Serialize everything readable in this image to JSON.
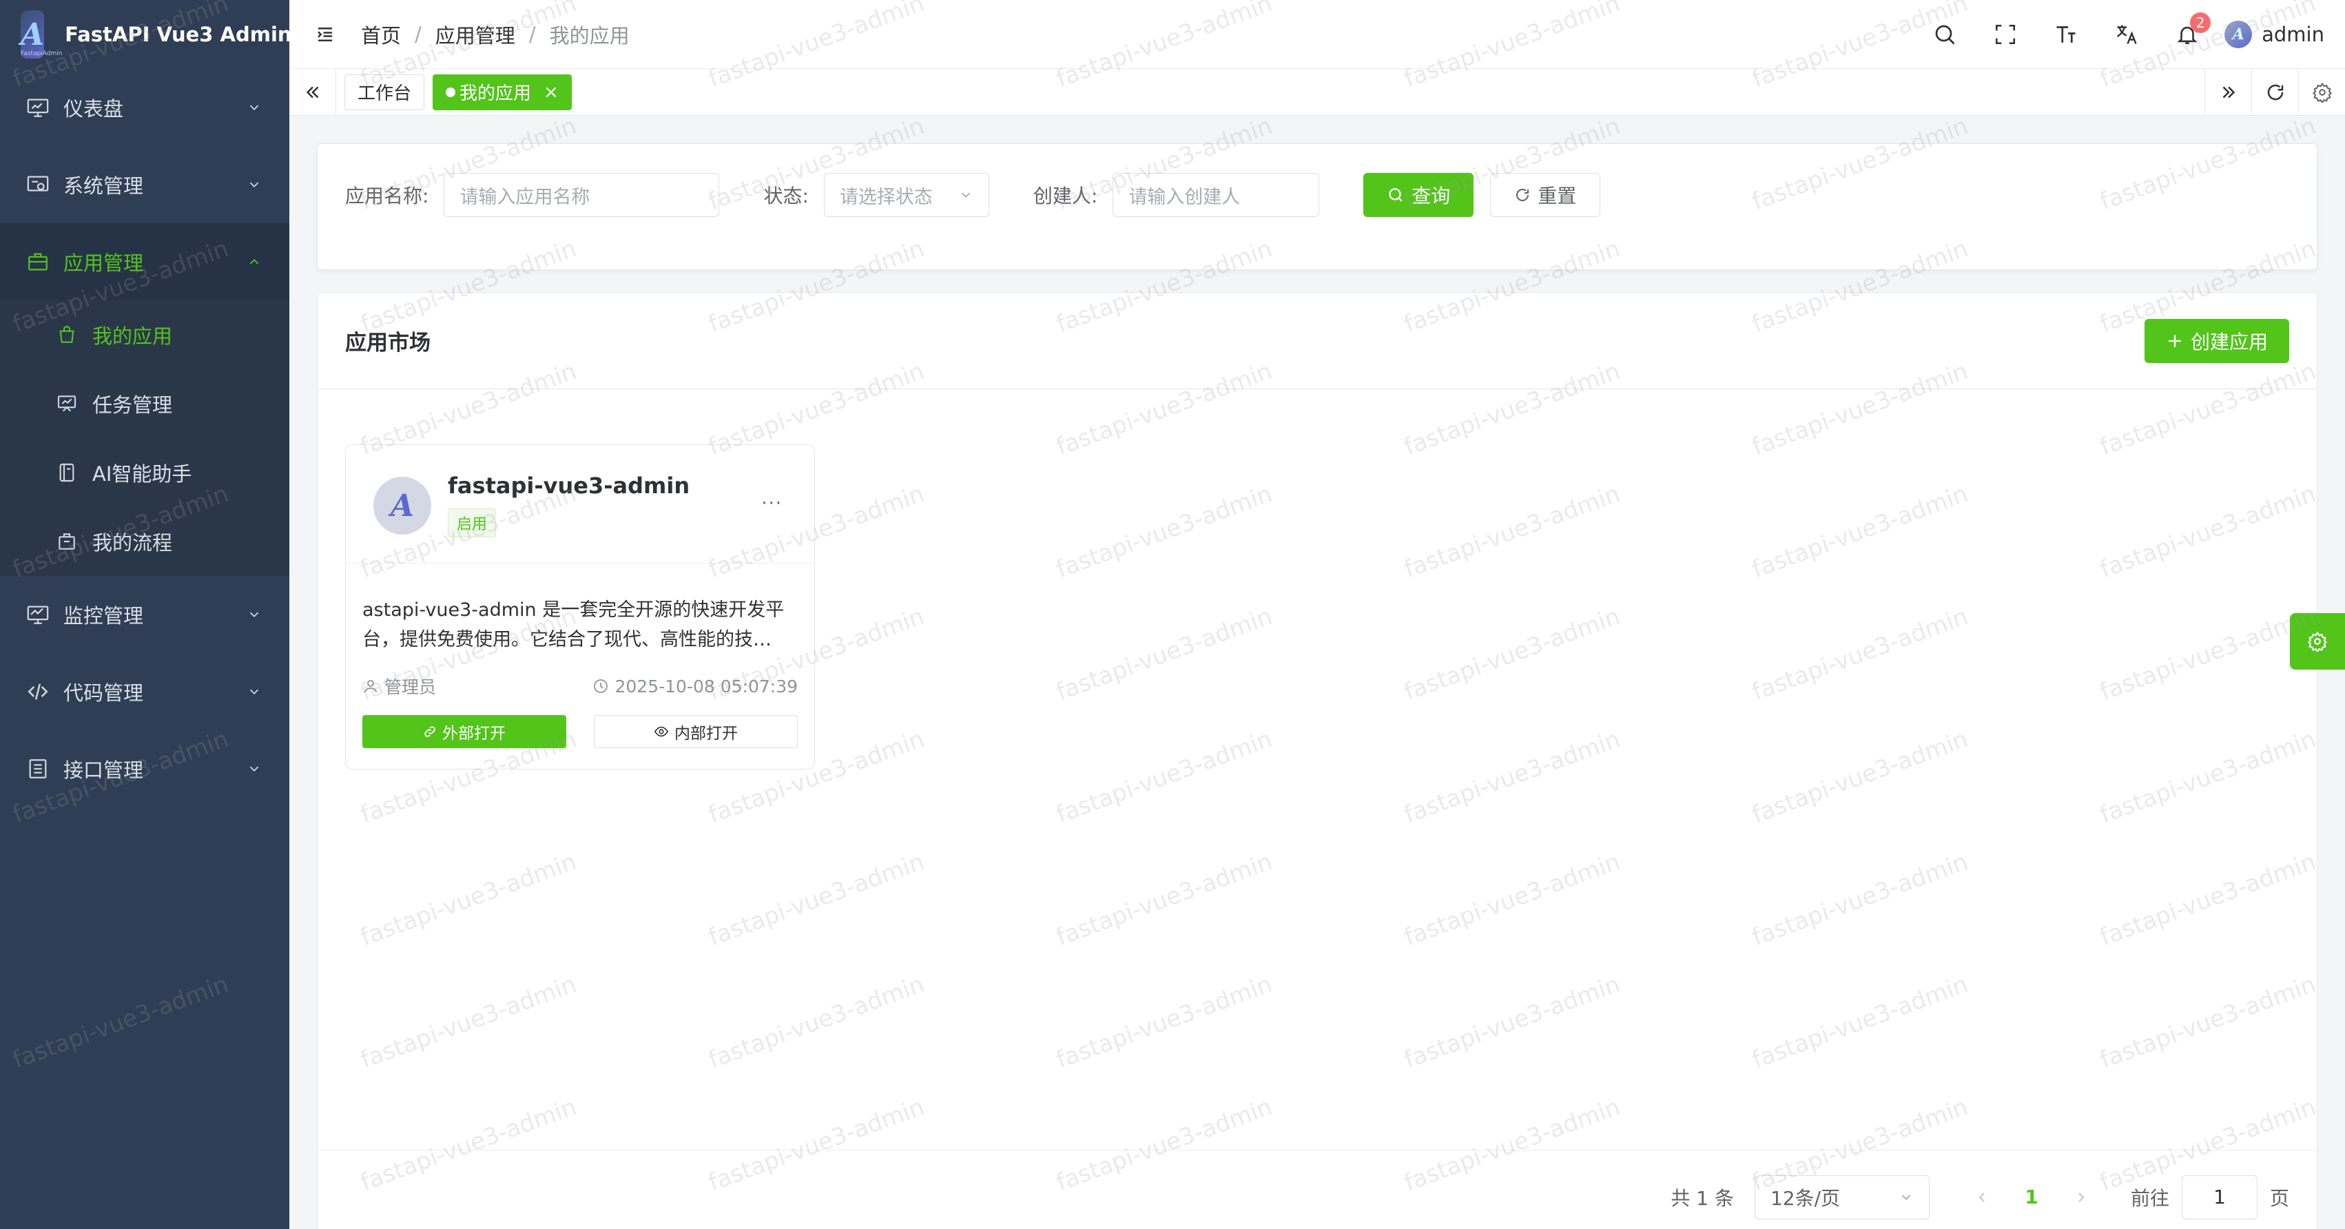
{
  "app": {
    "title": "FastAPI Vue3 Admin",
    "logo_caption": "FastapiAdmin",
    "logo_glyph": "A"
  },
  "sidebar": {
    "items": [
      {
        "label": "仪表盘",
        "icon": "monitor-icon",
        "expanded": false
      },
      {
        "label": "系统管理",
        "icon": "system-settings-icon",
        "expanded": false
      },
      {
        "label": "应用管理",
        "icon": "briefcase-icon",
        "expanded": true,
        "active": true
      },
      {
        "label": "监控管理",
        "icon": "chart-monitor-icon",
        "expanded": false
      },
      {
        "label": "代码管理",
        "icon": "code-icon",
        "expanded": false
      },
      {
        "label": "接口管理",
        "icon": "document-list-icon",
        "expanded": false
      }
    ],
    "subitems": [
      {
        "label": "我的应用",
        "icon": "shopping-bag-icon",
        "active": true
      },
      {
        "label": "任务管理",
        "icon": "presentation-icon"
      },
      {
        "label": "AI智能助手",
        "icon": "ai-notebook-icon"
      },
      {
        "label": "我的流程",
        "icon": "flow-bag-icon"
      }
    ]
  },
  "header": {
    "breadcrumb": [
      "首页",
      "应用管理",
      "我的应用"
    ],
    "notification_count": "2",
    "username": "admin",
    "avatar_glyph": "A"
  },
  "tabs": [
    {
      "label": "工作台",
      "active": false
    },
    {
      "label": "我的应用",
      "active": true,
      "close": "×"
    }
  ],
  "search": {
    "name_label": "应用名称:",
    "name_placeholder": "请输入应用名称",
    "status_label": "状态:",
    "status_placeholder": "请选择状态",
    "creator_label": "创建人:",
    "creator_placeholder": "请输入创建人",
    "query_btn": "查询",
    "reset_btn": "重置"
  },
  "market": {
    "title": "应用市场",
    "create_btn": "创建应用",
    "apps": [
      {
        "name": "fastapi-vue3-admin",
        "status": "启用",
        "more": "···",
        "description": "astapi-vue3-admin 是一套完全开源的快速开发平台，提供免费使用。它结合了现代、高性能的技…",
        "creator": "管理员",
        "time": "2025-10-08 05:07:39",
        "external_btn": "外部打开",
        "internal_btn": "内部打开",
        "avatar_glyph": "A"
      }
    ]
  },
  "pagination": {
    "total": "共 1 条",
    "page_size": "12条/页",
    "current_page": "1",
    "goto_label": "前往",
    "goto_value": "1",
    "page_suffix": "页"
  },
  "watermark": "fastapi-vue3-admin",
  "colors": {
    "primary": "#52c41a",
    "sidebar": "#2f3e54",
    "sidebar_active": "#263346",
    "badge": "#f56c6c"
  }
}
